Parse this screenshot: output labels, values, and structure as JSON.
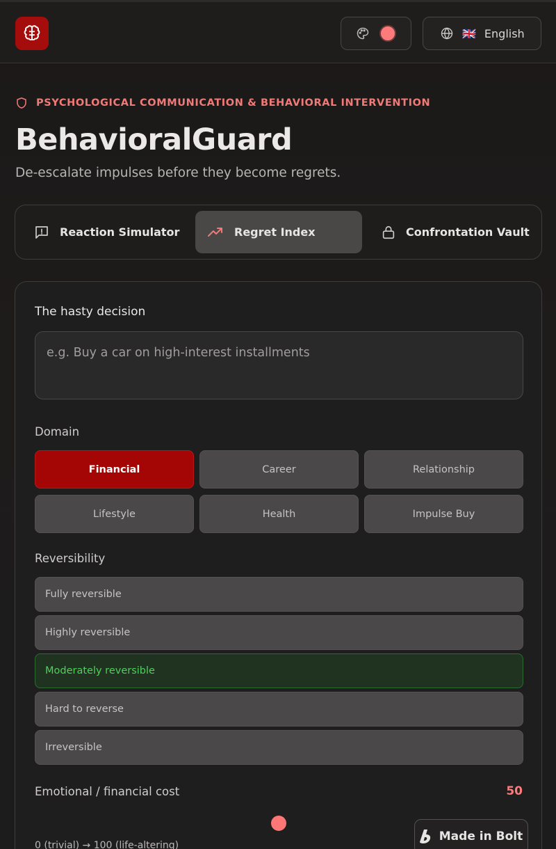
{
  "header": {
    "language": "English",
    "flag": "🇬🇧",
    "theme_swatch_color": "#ff7a7a",
    "brand_color": "#a50d0d"
  },
  "hero": {
    "eyebrow": "PSYCHOLOGICAL COMMUNICATION & BEHAVIORAL INTERVENTION",
    "title": "BehavioralGuard",
    "subtitle": "De-escalate impulses before they become regrets."
  },
  "tabs": [
    {
      "label": "Reaction Simulator",
      "icon": "message-alert-icon"
    },
    {
      "label": "Regret Index",
      "icon": "trending-up-icon",
      "active": true
    },
    {
      "label": "Confrontation Vault",
      "icon": "lock-icon"
    }
  ],
  "form": {
    "decision_label": "The hasty decision",
    "decision_placeholder": "e.g. Buy a car on high-interest installments",
    "decision_value": "",
    "domain_label": "Domain",
    "domains": [
      "Financial",
      "Career",
      "Relationship",
      "Lifestyle",
      "Health",
      "Impulse Buy"
    ],
    "selected_domain": "Financial",
    "reversibility_label": "Reversibility",
    "reversibility": [
      "Fully reversible",
      "Highly reversible",
      "Moderately reversible",
      "Hard to reverse",
      "Irreversible"
    ],
    "selected_reversibility": "Moderately reversible",
    "cost_label": "Emotional / financial cost",
    "cost_value": "50",
    "cost_hint": "0 (trivial) → 100 (life-altering)"
  },
  "badge": {
    "label": "Made in Bolt"
  }
}
